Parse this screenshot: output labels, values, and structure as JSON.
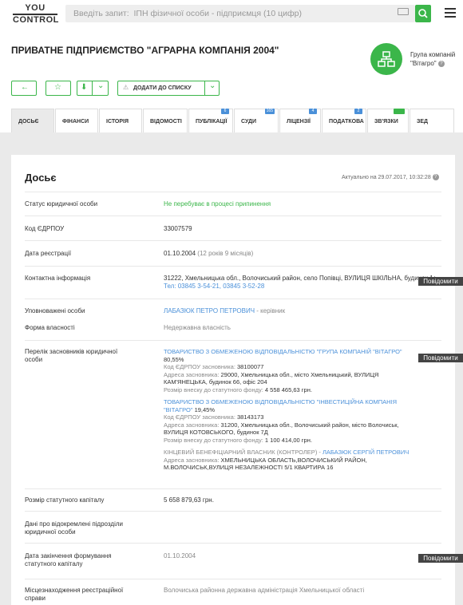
{
  "header": {
    "logo_top": "YOU",
    "logo_bottom": "CONTROL",
    "search_placeholder": "Введіть запит:  ІПН фізичної особи - підприємця (10 цифр)"
  },
  "company": {
    "title": "ПРИВАТНЕ ПІДПРИЄМСТВО \"АГРАРНА КОМПАНІЯ 2004\"",
    "group_label": "Група компаній",
    "group_name": "\"Вітагро\"",
    "info_glyph": "?"
  },
  "actions": {
    "back_glyph": "←",
    "fav_glyph": "☆",
    "download_glyph": "⬇",
    "dropdown_glyph": "⌄",
    "add_to_list": "ДОДАТИ ДО СПИСКУ",
    "add_to_list_icon_glyph": "⚠"
  },
  "tabs": [
    {
      "label": "ДОСЬЄ",
      "badge": ""
    },
    {
      "label": "ФІНАНСИ",
      "badge": ""
    },
    {
      "label": "ІСТОРІЯ",
      "badge": ""
    },
    {
      "label": "ВІДОМОСТІ",
      "badge": ""
    },
    {
      "label": "ПУБЛІКАЦІЇ",
      "badge": "6"
    },
    {
      "label": "СУДИ",
      "badge": "165"
    },
    {
      "label": "ЛІЦЕНЗІЇ",
      "badge": "4"
    },
    {
      "label": "ПОДАТКОВА",
      "badge": "2"
    },
    {
      "label": "ЗВ'ЯЗКИ",
      "badge": "beta"
    },
    {
      "label": "ЗЕД",
      "badge": ""
    }
  ],
  "dossier": {
    "title": "Досьє",
    "actual": "Актуально на 29.07.2017, 10:32:28",
    "actual_info_glyph": "?",
    "report_label": "Повідомити",
    "rows": {
      "status": {
        "label": "Статус юридичної особи",
        "value": "Не перебуває в процесі припинення"
      },
      "edrpou": {
        "label": "Код ЄДРПОУ",
        "value": "33007579"
      },
      "reg_date": {
        "label": "Дата реєстрації",
        "value": "01.10.2004",
        "extra": "(12 років 9 місяців)"
      },
      "contacts": {
        "label": "Контактна інформація",
        "address": "31222, Хмельницька обл., Волочиський район, село Попівці, ВУЛИЦЯ ШКІЛЬНА, будинок 14",
        "phone": "Тел: 03845 3-54-21, 03845 3-52-28"
      },
      "authorized": {
        "label": "Уповноважені особи",
        "name": "ЛАБАЗЮК ПЕТРО ПЕТРОВИЧ",
        "role": "- керівник"
      },
      "ownership": {
        "label": "Форма власності",
        "value": "Недержавна власність"
      },
      "founders": {
        "label": "Перелік засновників юридичної особи",
        "f1_name": "ТОВАРИСТВО З ОБМЕЖЕНОЮ ВІДПОВІДАЛЬНІСТЮ \"ГРУПА КОМПАНІЙ \"ВІТАГРО\"",
        "f1_share": "80,55%",
        "f1_code_label": "Код ЄДРПОУ засновника:",
        "f1_code": "38100077",
        "f1_addr_label": "Адреса засновника:",
        "f1_addr": "29000, Хмельницька обл., місто Хмельницький, ВУЛИЦЯ КАМ'ЯНЕЦЬКА, будинок 66, офіс 204",
        "f1_cap_label": "Розмір внеску до статутного фонду:",
        "f1_cap": "4 558 465,63 грн.",
        "f2_name": "ТОВАРИСТВО З ОБМЕЖЕНОЮ ВІДПОВІДАЛЬНІСТЮ \"ІНВЕСТИЦІЙНА КОМПАНІЯ \"ВІТАГРО\"",
        "f2_share": "19,45%",
        "f2_code_label": "Код ЄДРПОУ засновника:",
        "f2_code": "38143173",
        "f2_addr_label": "Адреса засновника:",
        "f2_addr": "31200, Хмельницька обл., Волочиський район, місто Волочиськ, ВУЛИЦЯ КОТОВСЬКОГО, будинок 7Д",
        "f2_cap_label": "Розмір внеску до статутного фонду:",
        "f2_cap": "1 100 414,00 грн.",
        "benef_label": "КІНЦЕВИЙ БЕНЕФІЦІАРНИЙ ВЛАСНИК (КОНТРОЛЕР) -",
        "benef_name": "ЛАБАЗЮК СЕРГІЙ ПЕТРОВИЧ",
        "benef_addr_label": "Адреса засновника:",
        "benef_addr": "ХМЕЛЬНИЦЬКА ОБЛАСТЬ,ВОЛОЧИСЬКИЙ РАЙОН, М.ВОЛОЧИСЬК,ВУЛИЦЯ НЕЗАЛЕЖНОСТІ 5/1 КВАРТИРА 16"
      },
      "capital": {
        "label": "Розмір статутного капіталу",
        "value": "5 658 879,63 грн."
      },
      "branches": {
        "label": "Дані про відокремлені підрозділи юридичної особи",
        "value": ""
      },
      "cap_date": {
        "label": "Дата закінчення формування статутного капіталу",
        "value": "01.10.2004"
      },
      "reg_place": {
        "label": "Місцезнаходження реєстраційної справи",
        "value": "Волочиська районна державна адміністрація Хмельницької області"
      }
    }
  }
}
